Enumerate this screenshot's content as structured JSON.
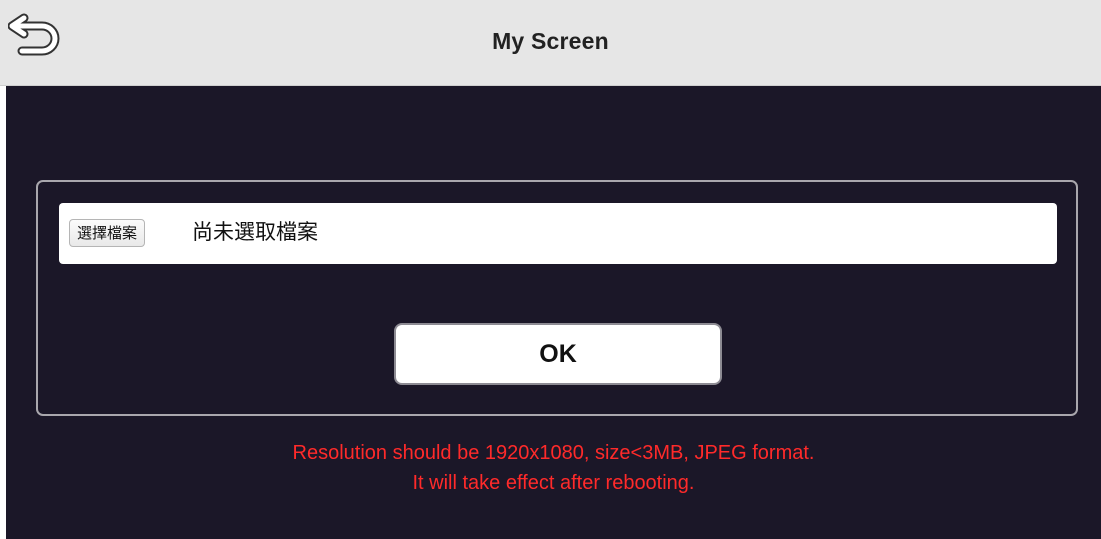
{
  "header": {
    "title": "My Screen",
    "back_icon": "back-arrow-icon"
  },
  "upload": {
    "choose_label": "選擇檔案",
    "file_status": "尚未選取檔案"
  },
  "actions": {
    "ok_label": "OK"
  },
  "notice": {
    "line1": "Resolution should be 1920x1080, size<3MB, JPEG format.",
    "line2": "It will take effect after rebooting."
  },
  "colors": {
    "header_bg": "#e6e6e6",
    "body_bg": "#1b1728",
    "notice_text": "#ff2a2a"
  }
}
